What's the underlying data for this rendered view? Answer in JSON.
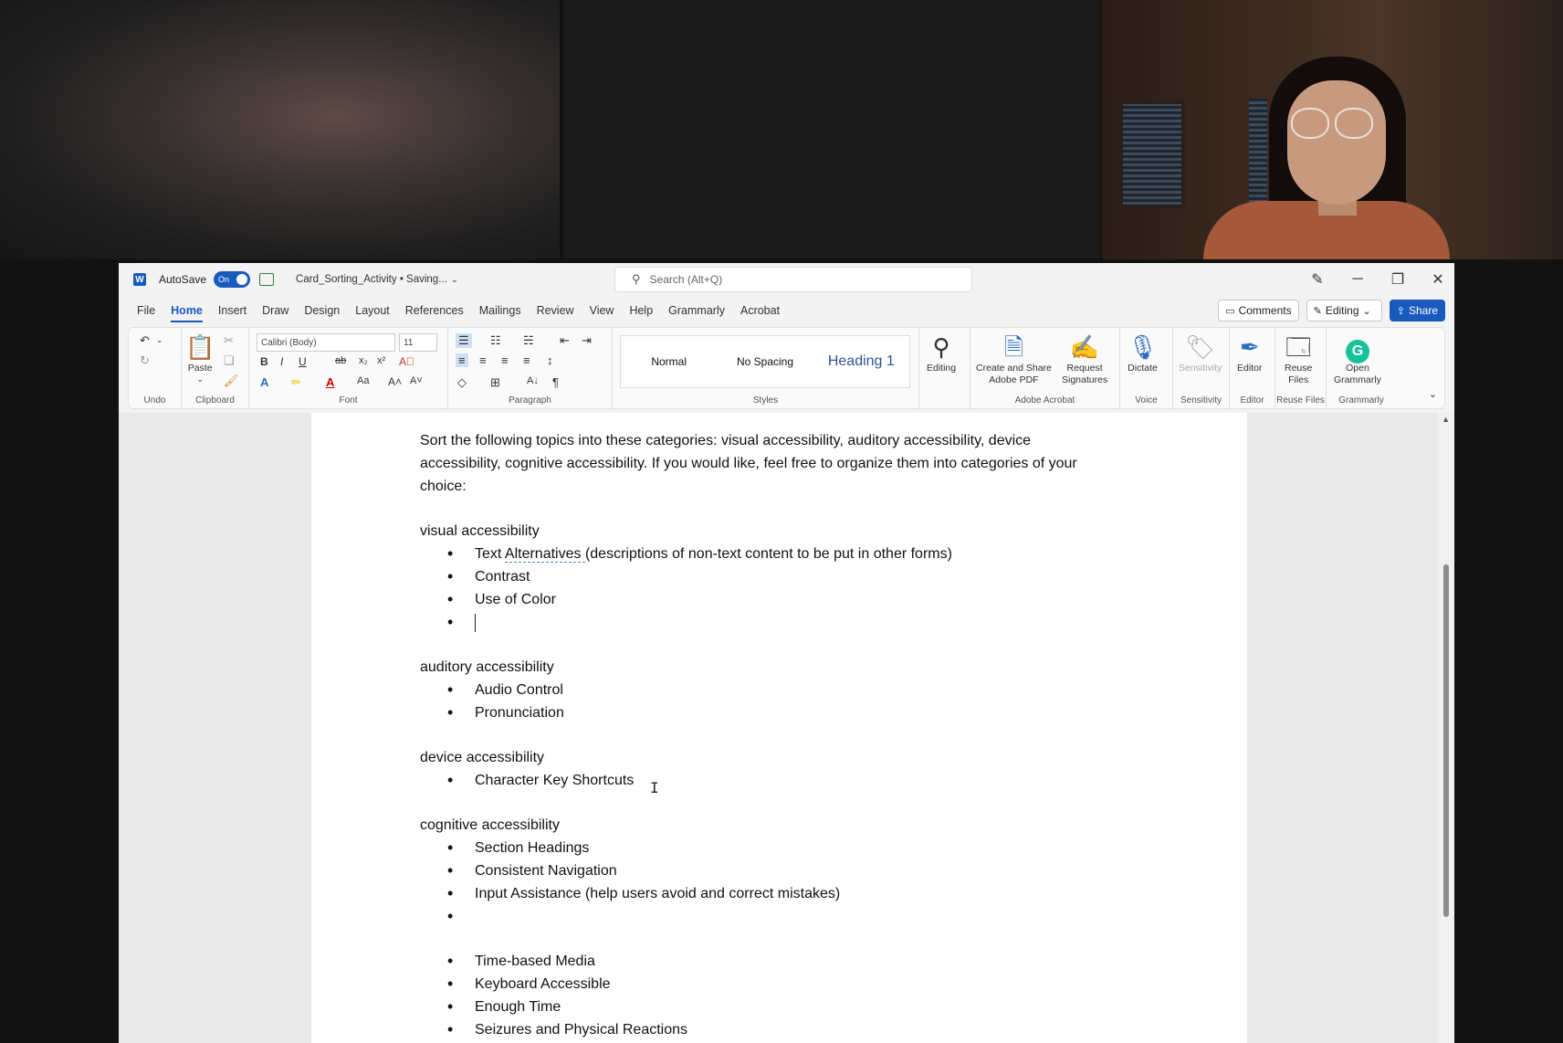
{
  "titlebar": {
    "autosave_label": "AutoSave",
    "autosave_state": "On",
    "doc_title": "Card_Sorting_Activity • Saving...",
    "search_placeholder": "Search (Alt+Q)"
  },
  "menu": {
    "tabs": [
      "File",
      "Home",
      "Insert",
      "Draw",
      "Design",
      "Layout",
      "References",
      "Mailings",
      "Review",
      "View",
      "Help",
      "Grammarly",
      "Acrobat"
    ],
    "active_tab": "Home",
    "comments_label": "Comments",
    "editing_label": "Editing",
    "share_label": "Share"
  },
  "ribbon": {
    "font_name": "Calibri (Body)",
    "font_size": "11",
    "paste_label": "Paste",
    "groups": {
      "undo": "Undo",
      "clipboard": "Clipboard",
      "font": "Font",
      "paragraph": "Paragraph",
      "styles": "Styles",
      "adobe": "Adobe Acrobat",
      "voice": "Voice",
      "sensitivity": "Sensitivity",
      "editor": "Editor",
      "reuse": "Reuse Files",
      "grammarly": "Grammarly"
    },
    "styles": [
      "Normal",
      "No Spacing",
      "Heading 1"
    ],
    "buttons": {
      "editing": "Editing",
      "create_pdf_1": "Create and Share",
      "create_pdf_2": "Adobe PDF",
      "request_1": "Request",
      "request_2": "Signatures",
      "dictate": "Dictate",
      "sensitivity": "Sensitivity",
      "editor": "Editor",
      "reuse_1": "Reuse",
      "reuse_2": "Files",
      "grammarly_1": "Open",
      "grammarly_2": "Grammarly"
    }
  },
  "document": {
    "intro_1": "Sort the following topics into these categories: visual accessibility, auditory accessibility, device",
    "intro_2": "accessibility, cognitive accessibility. If you would like, feel free to organize them into categories of your",
    "intro_3": "choice:",
    "visual_heading": "visual accessibility",
    "visual_item_1a": "Text ",
    "visual_item_1b": "Alternatives ",
    "visual_item_1c": " (descriptions of non-text content to be put in other forms)",
    "visual_item_2": "Contrast",
    "visual_item_3": "Use of Color",
    "auditory_heading": "auditory accessibility",
    "auditory_item_1": "Audio Control",
    "auditory_item_2": "Pronunciation",
    "device_heading": "device accessibility",
    "device_item_1": "Character Key Shortcuts",
    "cognitive_heading": "cognitive accessibility",
    "cognitive_item_1": "Section Headings",
    "cognitive_item_2": "Consistent Navigation",
    "cognitive_item_3": "Input Assistance (help users avoid and correct mistakes)",
    "remaining_1": "Time-based Media",
    "remaining_2": "Keyboard Accessible",
    "remaining_3": "Enough Time",
    "remaining_4": "Seizures and Physical Reactions"
  },
  "colors": {
    "accent": "#185abd",
    "heading1": "#2f5496",
    "grammarly": "#15c39a"
  }
}
